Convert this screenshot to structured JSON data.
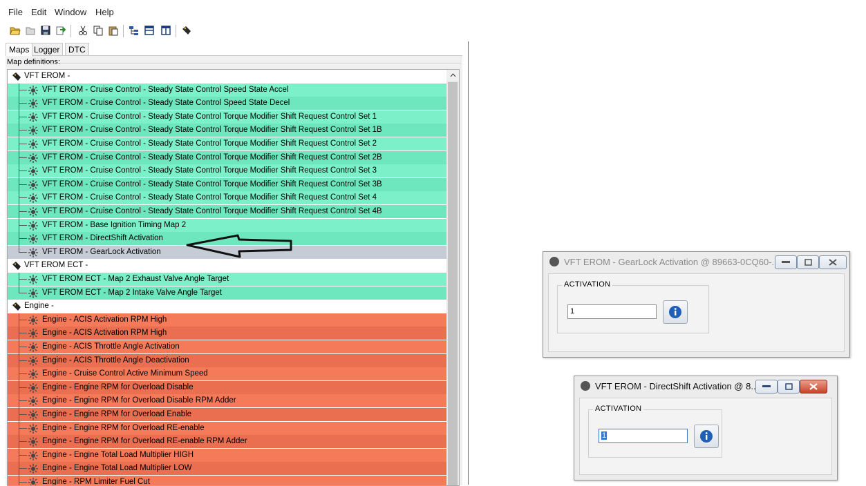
{
  "menu": [
    "File",
    "Edit",
    "Window",
    "Help"
  ],
  "toolbar_icons": [
    "open-icon",
    "save-as-icon",
    "save-icon",
    "export-icon",
    "cut-icon",
    "copy-icon",
    "paste-icon",
    "tree-icon",
    "split-horizontal-icon",
    "split-vertical-icon",
    "tag-icon"
  ],
  "tabs": [
    "Maps",
    "Logger",
    "DTC"
  ],
  "map_definitions_label": "Map definitions:",
  "tree": [
    {
      "type": "cat",
      "text": "VFT EROM -"
    },
    {
      "type": "green",
      "text": "VFT EROM -  Cruise Control - Steady State Control Speed State Accel"
    },
    {
      "type": "green",
      "text": "VFT EROM -  Cruise Control - Steady State Control Speed State Decel"
    },
    {
      "type": "green",
      "text": "VFT EROM -  Cruise Control - Steady State Control Torque Modifier Shift Request Control Set 1"
    },
    {
      "type": "green",
      "text": "VFT EROM -  Cruise Control - Steady State Control Torque Modifier Shift Request Control Set 1B"
    },
    {
      "type": "green",
      "text": "VFT EROM -  Cruise Control - Steady State Control Torque Modifier Shift Request Control Set 2"
    },
    {
      "type": "green",
      "text": "VFT EROM -  Cruise Control - Steady State Control Torque Modifier Shift Request Control Set 2B"
    },
    {
      "type": "green",
      "text": "VFT EROM -  Cruise Control - Steady State Control Torque Modifier Shift Request Control Set 3"
    },
    {
      "type": "green",
      "text": "VFT EROM -  Cruise Control - Steady State Control Torque Modifier Shift Request Control Set 3B"
    },
    {
      "type": "green",
      "text": "VFT EROM -  Cruise Control - Steady State Control Torque Modifier Shift Request Control Set 4"
    },
    {
      "type": "green",
      "text": "VFT EROM -  Cruise Control - Steady State Control Torque Modifier Shift Request Control Set 4B"
    },
    {
      "type": "green",
      "text": "VFT EROM - Base Ignition Timing Map 2"
    },
    {
      "type": "green",
      "text": "VFT EROM - DirectShift Activation"
    },
    {
      "type": "selected",
      "text": "VFT EROM - GearLock Activation"
    },
    {
      "type": "cat",
      "text": "VFT EROM ECT -"
    },
    {
      "type": "green",
      "text": "VFT EROM ECT - Map 2 Exhaust Valve Angle Target"
    },
    {
      "type": "green",
      "text": "VFT EROM ECT - Map 2 Intake Valve Angle Target"
    },
    {
      "type": "cat",
      "text": "Engine -"
    },
    {
      "type": "red",
      "text": "Engine - ACIS Activation RPM High"
    },
    {
      "type": "red",
      "text": "Engine - ACIS Activation RPM High"
    },
    {
      "type": "red",
      "text": "Engine - ACIS Throttle Angle Activation"
    },
    {
      "type": "red",
      "text": "Engine - ACIS Throttle Angle Deactivation"
    },
    {
      "type": "red",
      "text": "Engine - Cruise Control Active Minimum Speed"
    },
    {
      "type": "red",
      "text": "Engine - Engine RPM for Overload Disable"
    },
    {
      "type": "red",
      "text": "Engine - Engine RPM for Overload Disable RPM Adder"
    },
    {
      "type": "red",
      "text": "Engine - Engine RPM for Overload Enable"
    },
    {
      "type": "red",
      "text": "Engine - Engine RPM for Overload RE-enable"
    },
    {
      "type": "red",
      "text": "Engine - Engine RPM for Overload RE-enable RPM Adder"
    },
    {
      "type": "red",
      "text": "Engine - Engine Total Load Multiplier HIGH"
    },
    {
      "type": "red",
      "text": "Engine - Engine Total Load Multiplier LOW"
    },
    {
      "type": "red",
      "text": "Engine - RPM Limiter Fuel Cut"
    }
  ],
  "dialog_gearlock": {
    "title": "VFT EROM - GearLock Activation @ 89663-0CQ60-...",
    "group_label": "ACTIVATION",
    "value": "1"
  },
  "dialog_directshift": {
    "title": "VFT EROM - DirectShift Activation @ 8...",
    "group_label": "ACTIVATION",
    "value": "1"
  },
  "colors": {
    "green_row": "#7cf0c9",
    "red_row": "#f47a5a",
    "selected_row": "#c6ccd6",
    "close_button": "#c8432a"
  }
}
